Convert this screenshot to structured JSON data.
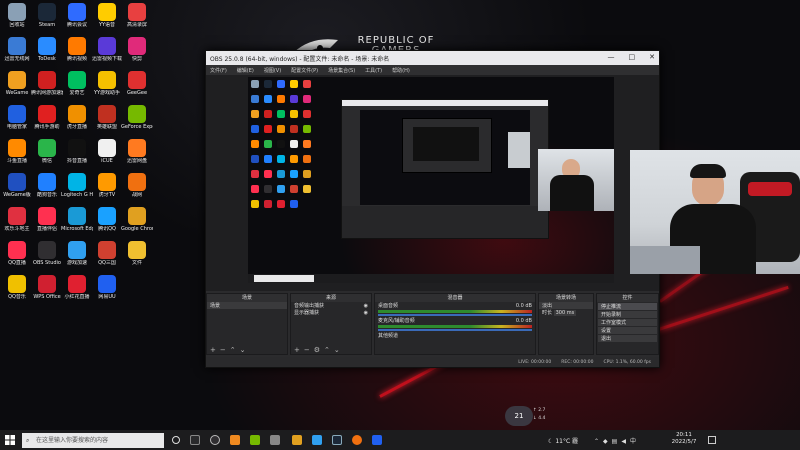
{
  "desktop": {
    "rog_brand_line1": "REPUBLIC OF",
    "rog_brand_line2": "GAMERS",
    "icons": [
      {
        "label": "回收站",
        "color": "#8aa0b5"
      },
      {
        "label": "Steam",
        "color": "#1b2838"
      },
      {
        "label": "腾讯会议",
        "color": "#2f6bff"
      },
      {
        "label": "YY语音",
        "color": "#ffcc00"
      },
      {
        "label": "高清录屏",
        "color": "#e84040"
      },
      {
        "label": "迅雷无线网",
        "color": "#3a7bd5"
      },
      {
        "label": "ToDesk",
        "color": "#2a8cff"
      },
      {
        "label": "腾讯视频",
        "color": "#ff7a00"
      },
      {
        "label": "迅雷视频下载",
        "color": "#5a3ad8"
      },
      {
        "label": "快剪",
        "color": "#e02a7a"
      },
      {
        "label": "WeGame",
        "color": "#f0a020"
      },
      {
        "label": "腾讯网游加速器",
        "color": "#d02020"
      },
      {
        "label": "爱奇艺",
        "color": "#00c060"
      },
      {
        "label": "YY游戏助手",
        "color": "#f5c000"
      },
      {
        "label": "GeeGee",
        "color": "#e03030"
      },
      {
        "label": "电脑管家",
        "color": "#2060e0"
      },
      {
        "label": "腾讯手游助",
        "color": "#e02020"
      },
      {
        "label": "虎牙直播",
        "color": "#f09000"
      },
      {
        "label": "英雄联盟",
        "color": "#c03020"
      },
      {
        "label": "GeForce Experience",
        "color": "#76b900"
      },
      {
        "label": "斗鱼直播",
        "color": "#ff8a00"
      },
      {
        "label": "微信",
        "color": "#2ab54a"
      },
      {
        "label": "抖音直播",
        "color": "#111111"
      },
      {
        "label": "iCUE",
        "color": "#f0f0f0"
      },
      {
        "label": "迅雷网盘",
        "color": "#ff7a20"
      },
      {
        "label": "WeGame版",
        "color": "#2050c0"
      },
      {
        "label": "酷狗音乐",
        "color": "#2080ff"
      },
      {
        "label": "Logitech G HUB",
        "color": "#00b4e6"
      },
      {
        "label": "虎牙TV",
        "color": "#ff9a00"
      },
      {
        "label": "战网",
        "color": "#f07010"
      },
      {
        "label": "欢乐斗地主",
        "color": "#e03040"
      },
      {
        "label": "直播伴侣",
        "color": "#ff3050"
      },
      {
        "label": "Microsoft Edge",
        "color": "#1a9ad6"
      },
      {
        "label": "腾讯QQ",
        "color": "#1aa1ff"
      },
      {
        "label": "Google Chrome",
        "color": "#e0a020"
      },
      {
        "label": "QQ直播",
        "color": "#ff3050"
      },
      {
        "label": "OBS Studio",
        "color": "#302e31"
      },
      {
        "label": "游戏加速",
        "color": "#30a0f0"
      },
      {
        "label": "QQ三国",
        "color": "#d04030"
      },
      {
        "label": "文件",
        "color": "#f0c030"
      },
      {
        "label": "QQ音乐",
        "color": "#f0c000"
      },
      {
        "label": "WPS Office",
        "color": "#d02030"
      },
      {
        "label": "小红花直播",
        "color": "#e02030"
      },
      {
        "label": "网易UU",
        "color": "#2060f0"
      }
    ]
  },
  "obs": {
    "title": "OBS 25.0.8 (64-bit, windows) - 配置文件: 未命名 - 场景: 未命名",
    "win_buttons": [
      "—",
      "□",
      "✕"
    ],
    "menu": [
      "文件(F)",
      "编辑(E)",
      "视图(V)",
      "配置文件(P)",
      "场景集合(S)",
      "工具(T)",
      "帮助(H)"
    ],
    "docks": {
      "scenes": {
        "header": "场景",
        "items": [
          "场景"
        ]
      },
      "sources": {
        "header": "来源",
        "items": [
          "音频输出捕获",
          "显示器捕获"
        ]
      },
      "mixer": {
        "header": "混音器",
        "channels": [
          {
            "name": "桌面音频",
            "level": "0.0 dB"
          },
          {
            "name": "麦克风/辅助音频",
            "level": "0.0 dB"
          }
        ],
        "extra": "其他频道"
      },
      "transitions": {
        "header": "场景转场",
        "fade_label": "淡出",
        "duration_label": "时长",
        "duration_value": "300 ms"
      },
      "controls": {
        "header": "控件",
        "buttons": [
          "停止推流",
          "开始录制",
          "工作室模式",
          "设置",
          "退出"
        ]
      }
    },
    "status": {
      "live": "LIVE: 00:00:00",
      "rec": "REC: 00:00:00",
      "cpu": "CPU: 1.1%, 60.00 fps"
    }
  },
  "taskbar": {
    "search_placeholder": "在这里输入你要搜索的内容",
    "weather": "11°C 霾",
    "time": "20:11",
    "date": "2022/5/7",
    "temp_widget": "21",
    "net_up": "2.7",
    "net_down": "4.4"
  }
}
